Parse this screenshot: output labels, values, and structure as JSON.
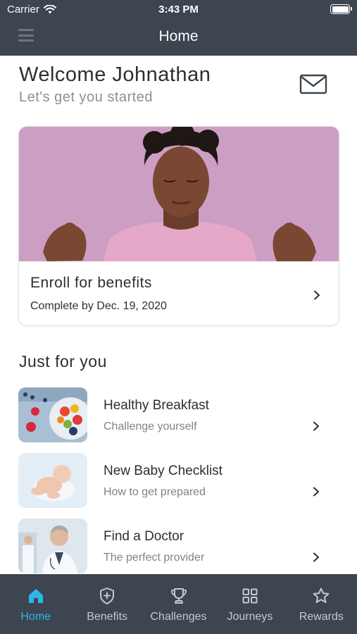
{
  "status_bar": {
    "carrier": "Carrier",
    "time": "3:43 PM"
  },
  "header": {
    "title": "Home",
    "menu_icon": "hamburger-icon"
  },
  "welcome": {
    "title": "Welcome Johnathan",
    "subtitle": "Let's get you started",
    "mail_icon": "envelope-icon"
  },
  "enroll_card": {
    "title": "Enroll for benefits",
    "subtitle": "Complete by Dec. 19, 2020"
  },
  "just_for_you": {
    "title": "Just for you",
    "items": [
      {
        "title": "Healthy Breakfast",
        "subtitle": "Challenge yourself"
      },
      {
        "title": "New Baby Checklist",
        "subtitle": "How to get prepared"
      },
      {
        "title": "Find a Doctor",
        "subtitle": "The perfect provider"
      }
    ]
  },
  "tabs": [
    {
      "label": "Home",
      "icon": "home-icon",
      "active": true
    },
    {
      "label": "Benefits",
      "icon": "shield-plus-icon",
      "active": false
    },
    {
      "label": "Challenges",
      "icon": "trophy-icon",
      "active": false
    },
    {
      "label": "Journeys",
      "icon": "grid-icon",
      "active": false
    },
    {
      "label": "Rewards",
      "icon": "star-icon",
      "active": false
    }
  ],
  "colors": {
    "header_bg": "#3c4550",
    "accent": "#2fb6e6",
    "text": "#2b2f33",
    "muted_text": "#8a9096"
  }
}
